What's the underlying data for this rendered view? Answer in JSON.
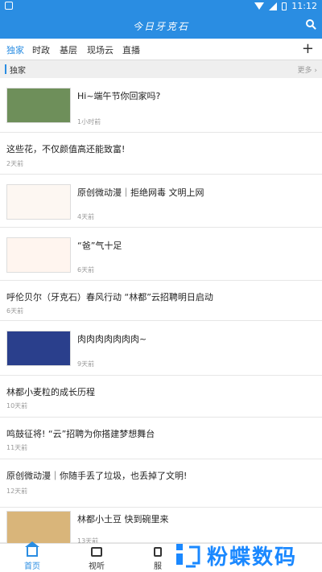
{
  "status": {
    "time": "11:12"
  },
  "app": {
    "title": "今日牙克石"
  },
  "tabs": [
    {
      "label": "独家",
      "active": true
    },
    {
      "label": "时政"
    },
    {
      "label": "基层"
    },
    {
      "label": "现场云"
    },
    {
      "label": "直播"
    }
  ],
  "section": {
    "title": "独家",
    "more": "更多"
  },
  "items": [
    {
      "title": "Hi~端午节你回家吗?",
      "time": "1小时前",
      "thumb": "dragon-boat-thumb"
    },
    {
      "title": "这些花，不仅颜值高还能致富!",
      "time": "2天前"
    },
    {
      "title": "原创微动漫｜拒绝网毒 文明上网",
      "time": "4天前",
      "thumb": "cartoon-thumb"
    },
    {
      "title": "“爸”气十足",
      "time": "6天前",
      "thumb": "father-thumb"
    },
    {
      "title": "呼伦贝尔（牙克石）春风行动 “林都”云招聘明日启动",
      "time": "6天前"
    },
    {
      "title": "肉肉肉肉肉肉肉~",
      "time": "9天前",
      "thumb": "meat-thumb"
    },
    {
      "title": "林都小麦粒的成长历程",
      "time": "10天前"
    },
    {
      "title": "鸣鼓征将! “云”招聘为你搭建梦想舞台",
      "time": "11天前"
    },
    {
      "title": "原创微动漫｜你随手丢了垃圾，也丢掉了文明!",
      "time": "12天前"
    },
    {
      "title": "林都小土豆 快到碗里来",
      "time": "13天前",
      "thumb": "potato-thumb"
    }
  ],
  "bottom_nav": [
    {
      "label": "首页",
      "active": true
    },
    {
      "label": "视听"
    },
    {
      "label": "服"
    }
  ],
  "watermark": {
    "text": "粉蝶数码"
  },
  "colors": {
    "accent": "#2a8de2",
    "watermark": "#1a88ff"
  }
}
